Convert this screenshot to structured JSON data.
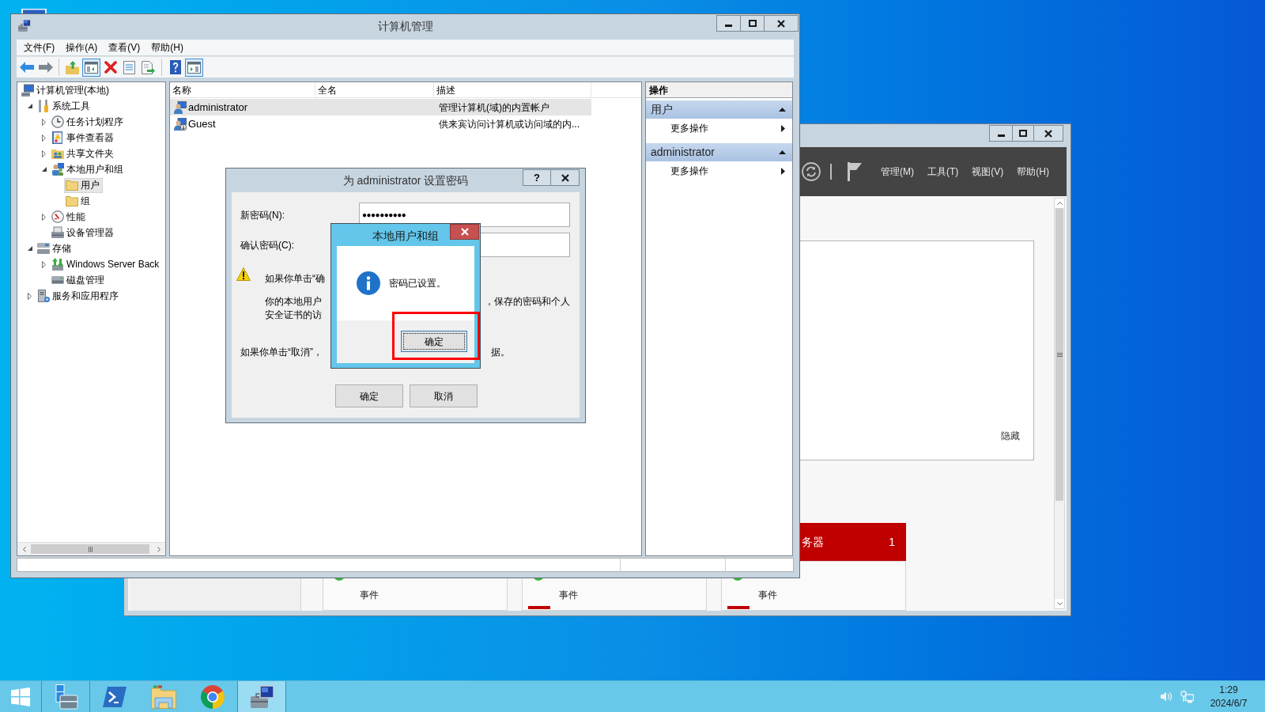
{
  "computer_management": {
    "title": "计算机管理",
    "menu": [
      "文件(F)",
      "操作(A)",
      "查看(V)",
      "帮助(H)"
    ],
    "toolbar": [
      [
        {
          "kind": "back",
          "on": false
        },
        {
          "kind": "forward",
          "on": false
        }
      ],
      [
        {
          "kind": "up",
          "on": false
        },
        {
          "kind": "tree",
          "on": true
        },
        {
          "kind": "delete",
          "on": false
        },
        {
          "kind": "properties",
          "on": false
        },
        {
          "kind": "export",
          "on": false
        }
      ],
      [
        {
          "kind": "help",
          "on": false
        },
        {
          "kind": "actions",
          "on": true
        }
      ]
    ],
    "tree": [
      {
        "label": "计算机管理(本地)",
        "kind": "computer",
        "selected": false,
        "children": [
          {
            "label": "系统工具",
            "kind": "tools",
            "expanded": true,
            "selected": false,
            "children": [
              {
                "label": "任务计划程序",
                "kind": "clock",
                "expanded": false,
                "selected": false
              },
              {
                "label": "事件查看器",
                "kind": "event",
                "expanded": false,
                "selected": false
              },
              {
                "label": "共享文件夹",
                "kind": "shared",
                "expanded": false,
                "selected": false
              },
              {
                "label": "本地用户和组",
                "kind": "users",
                "expanded": true,
                "selected": false,
                "children": [
                  {
                    "label": "用户",
                    "kind": "folder",
                    "selected": true
                  },
                  {
                    "label": "组",
                    "kind": "folder",
                    "selected": false
                  }
                ]
              },
              {
                "label": "性能",
                "kind": "performance",
                "expanded": false,
                "selected": false
              },
              {
                "label": "设备管理器",
                "kind": "device",
                "selected": false
              }
            ]
          },
          {
            "label": "存储",
            "kind": "storage",
            "expanded": true,
            "selected": false,
            "children": [
              {
                "label": "Windows Server Back",
                "kind": "backup",
                "expanded": false,
                "selected": false
              },
              {
                "label": "磁盘管理",
                "kind": "disk",
                "selected": false
              }
            ]
          },
          {
            "label": "服务和应用程序",
            "kind": "services",
            "expanded": false,
            "selected": false
          }
        ]
      }
    ],
    "list": {
      "columns": [
        "名称",
        "全名",
        "描述"
      ],
      "rows": [
        {
          "name": "administrator",
          "description": "管理计算机(域)的内置帐户",
          "disabled": false,
          "selected": true
        },
        {
          "name": "Guest",
          "description": "供来宾访问计算机或访问域的内...",
          "disabled": true,
          "selected": false
        }
      ]
    },
    "actions": {
      "title": "操作",
      "sections": [
        {
          "title": "用户",
          "expanded": true,
          "items": [
            "更多操作"
          ]
        },
        {
          "title": "administrator",
          "expanded": true,
          "items": [
            "更多操作"
          ]
        }
      ]
    }
  },
  "server_manager": {
    "menu": [
      "管理(M)",
      "工具(T)",
      "视图(V)",
      "帮助(H)"
    ],
    "hide_link": "隐藏",
    "tiles": [
      {
        "label": "事件",
        "alert": false
      },
      {
        "label": "事件",
        "alert": true
      },
      {
        "title": "务器",
        "count": "1",
        "label": "事件",
        "alert": true
      }
    ]
  },
  "password_dialog": {
    "title": "为 administrator 设置密码",
    "help": "?",
    "fields": [
      {
        "label": "新密码(N):",
        "value": "●●●●●●●●●●"
      },
      {
        "label": "确认密码(C):"
      }
    ],
    "warning": [
      {
        "left": "如果你单击“确"
      },
      {
        "left": "你的本地用户",
        "right": "，保存的密码和个人"
      },
      {
        "left": "安全证书的访"
      }
    ],
    "cancel_note": {
      "left": "如果你单击“取消”，",
      "right": "据。"
    },
    "buttons": [
      "确定",
      "取消"
    ]
  },
  "message_box": {
    "title": "本地用户和组",
    "message": "密码已设置。",
    "button": {
      "label": "确定",
      "focused": true
    }
  },
  "taskbar": {
    "apps": [
      {
        "kind": "server_manager",
        "running": true,
        "selected": false
      },
      {
        "kind": "powershell",
        "running": false,
        "selected": false
      },
      {
        "kind": "explorer",
        "running": false,
        "selected": false
      },
      {
        "kind": "browser",
        "running": false,
        "selected": false
      },
      {
        "kind": "computer_management",
        "running": true,
        "selected": true
      }
    ],
    "time": "1:29",
    "date": "2024/6/7"
  }
}
